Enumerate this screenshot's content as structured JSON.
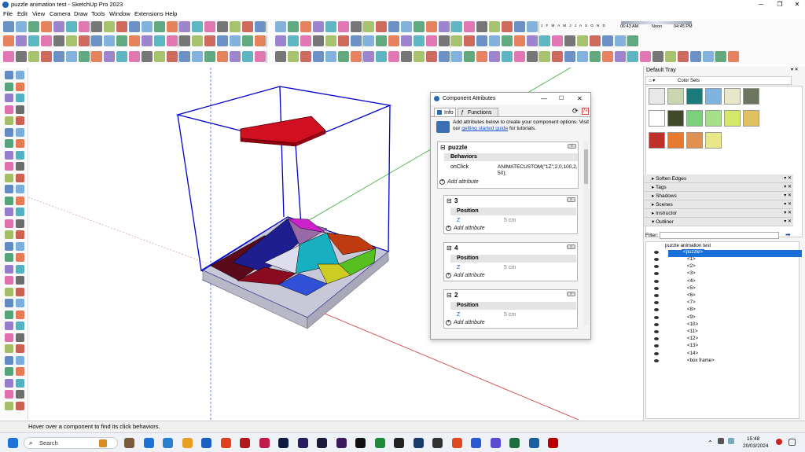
{
  "app": {
    "title": "puzzle animation test - SketchUp Pro 2023"
  },
  "menu": [
    "File",
    "Edit",
    "View",
    "Camera",
    "Draw",
    "Tools",
    "Window",
    "Extensions",
    "Help"
  ],
  "shadow_bar": {
    "months": "J F M A M J J A S O N D",
    "time_start": "06:43 AM",
    "noon": "Noon",
    "time_end": "04:45 PM"
  },
  "dialog": {
    "title": "Component Attributes",
    "tabs": [
      "Info",
      "Functions"
    ],
    "intro_text": "Add attributes below to create your component options. Visit our",
    "intro_link": "getting started guide",
    "intro_suffix": "for tutorials.",
    "root": {
      "name": "puzzle",
      "section": "Behaviors",
      "attr_name": "onClick",
      "attr_value_1": "ANIMATECUSTOM(\"1Z\",2,0,100,2,",
      "attr_value_2": "50);",
      "add_label": "Add attribute"
    },
    "children": [
      {
        "name": "3",
        "section": "Position",
        "attr": "Z",
        "value": "5 cm",
        "add": "Add attribute"
      },
      {
        "name": "4",
        "section": "Position",
        "attr": "Z",
        "value": "5 cm",
        "add": "Add attribute"
      },
      {
        "name": "2",
        "section": "Position",
        "attr": "Z",
        "value": "5 cm",
        "add": "Add attribute"
      }
    ]
  },
  "tray": {
    "title": "Default Tray",
    "color_sets": "Color Sets",
    "panels": [
      "Soften Edges",
      "Tags",
      "Shadows",
      "Scenes",
      "Instructor",
      "Outliner"
    ],
    "filter_label": "Filter:",
    "outliner_root": "puzzle animation test",
    "outliner_selected": "<puzzle>",
    "outliner_items": [
      "<1>",
      "<2>",
      "<3>",
      "<4>",
      "<5>",
      "<6>",
      "<7>",
      "<8>",
      "<9>",
      "<10>",
      "<11>",
      "<12>",
      "<13>",
      "<14>",
      "<box frame>"
    ],
    "swatch_colors": [
      "#e8e8e8",
      "#c9d6b0",
      "#1b7a7a",
      "#7fb3e0",
      "#e8e7c9",
      "#6b7560",
      "#ffffff",
      "#404a2a",
      "#7bd07b",
      "#a8e08a",
      "#d6e86a",
      "#e0c060",
      "#c0302a",
      "#e87a30",
      "#e09050",
      "#e8e88a"
    ]
  },
  "status": {
    "hint": "Hover over a component to find its click behaviors."
  },
  "taskbar": {
    "search": "Search",
    "time": "15:48",
    "date": "20/03/2024"
  }
}
